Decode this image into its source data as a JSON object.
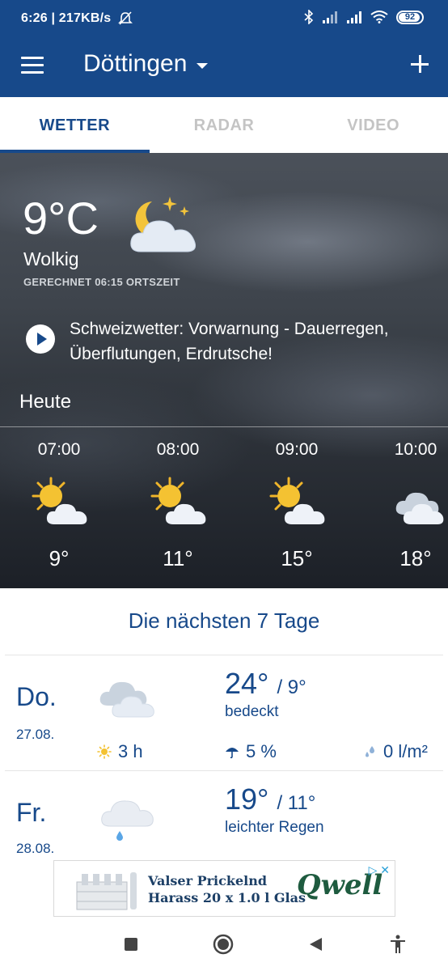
{
  "status_bar": {
    "time_speed": "6:26 | 217KB/s",
    "battery": "92"
  },
  "app_bar": {
    "location": "Döttingen"
  },
  "tabs": [
    {
      "label": "WETTER",
      "active": true
    },
    {
      "label": "RADAR",
      "active": false
    },
    {
      "label": "VIDEO",
      "active": false
    }
  ],
  "current": {
    "temperature": "9°C",
    "condition": "Wolkig",
    "calculated": "GERECHNET 06:15 ORTSZEIT",
    "icon": "partly-cloudy-night-icon"
  },
  "news": {
    "text": "Schweizwetter: Vorwarnung - Dauerregen, Überflutungen, Erdrutsche!"
  },
  "today": {
    "label": "Heute",
    "hours": [
      {
        "time": "07:00",
        "temp": "9°",
        "icon": "sun-cloud-icon"
      },
      {
        "time": "08:00",
        "temp": "11°",
        "icon": "sun-cloud-icon"
      },
      {
        "time": "09:00",
        "temp": "15°",
        "icon": "sun-cloud-icon"
      },
      {
        "time": "10:00",
        "temp": "18°",
        "icon": "cloudy-icon"
      }
    ]
  },
  "week": {
    "title": "Die nächsten 7 Tage",
    "days": [
      {
        "name": "Do.",
        "date": "27.08.",
        "high": "24°",
        "low": "/ 9°",
        "desc": "bedeckt",
        "sun": "3 h",
        "rain_chance": "5 %",
        "rain_amount": "0 l/m²",
        "icon": "overcast-icon"
      },
      {
        "name": "Fr.",
        "date": "28.08.",
        "high": "19°",
        "low": "/ 11°",
        "desc": "leichter Regen",
        "icon": "light-rain-icon"
      }
    ]
  },
  "ad": {
    "line1": "Valser Prickelnd",
    "line2": "Harass 20 x 1.0 l Glas",
    "brand": "Qwell",
    "choices": "▷ ✕"
  }
}
